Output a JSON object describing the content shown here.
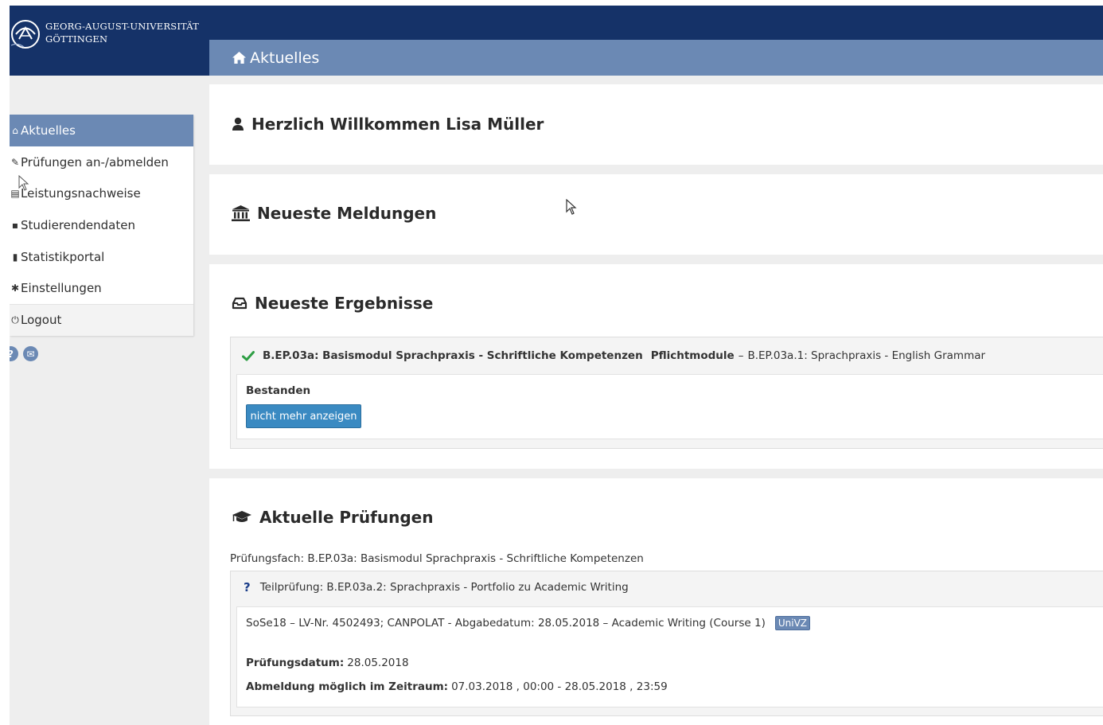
{
  "university": {
    "line1": "GEORG-AUGUST-UNIVERSITÄT",
    "line2": "GÖTTINGEN"
  },
  "header": {
    "title": "Aktuelles",
    "icon": "home-icon"
  },
  "colors": {
    "navy": "#153268",
    "accent": "#6b89b4",
    "button": "#3a8ac2",
    "success": "#2e9e44"
  },
  "sidebar": {
    "items": [
      {
        "label": "Aktuelles",
        "icon": "home-icon",
        "active": true
      },
      {
        "label": "Prüfungen an-/abmelden",
        "icon": "edit-icon"
      },
      {
        "label": "Leistungsnachweise",
        "icon": "document-icon"
      },
      {
        "label": "Studierendendaten",
        "icon": "id-card-icon"
      },
      {
        "label": "Statistikportal",
        "icon": "bar-chart-icon"
      },
      {
        "label": "Einstellungen",
        "icon": "gear-icon"
      },
      {
        "label": "Logout",
        "icon": "power-icon"
      }
    ],
    "help_icon": "?",
    "mail_icon": "✉"
  },
  "welcome": {
    "title": "Herzlich Willkommen Lisa Müller"
  },
  "news": {
    "title": "Neueste Meldungen"
  },
  "results": {
    "title": "Neueste Ergebnisse",
    "item": {
      "module": "B.EP.03a: Basismodul Sprachpraxis - Schriftliche Kompetenzen",
      "category": "Pflichtmodule",
      "separator": "–",
      "sub": "B.EP.03a.1: Sprachpraxis - English Grammar",
      "status": "Bestanden",
      "button_label": "nicht mehr anzeigen"
    }
  },
  "exams": {
    "title": "Aktuelle Prüfungen",
    "fach": "Prüfungsfach: B.EP.03a: Basismodul Sprachpraxis - Schriftliche Kompetenzen",
    "teil": "Teilprüfung: B.EP.03a.2: Sprachpraxis - Portfolio zu Academic Writing",
    "q_mark": "?",
    "course": "SoSe18 – LV-Nr. 4502493; CANPOLAT - Abgabedatum: 28.05.2018 – Academic Writing (Course 1)",
    "badge": "UniVZ",
    "date_label": "Prüfungsdatum:",
    "date_value": "28.05.2018",
    "dereg_label": "Abmeldung möglich im Zeitraum:",
    "dereg_value": "07.03.2018 , 00:00 - 28.05.2018 , 23:59"
  }
}
